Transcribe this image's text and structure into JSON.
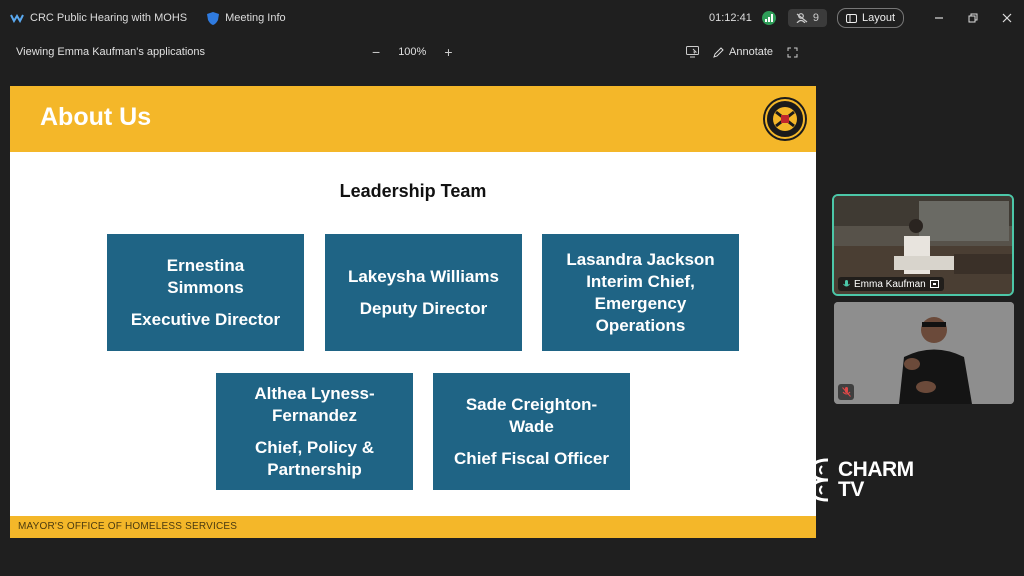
{
  "titlebar": {
    "meeting_title": "CRC Public Hearing with MOHS",
    "meeting_info": "Meeting Info",
    "timer": "01:12:41",
    "participants_count": "9",
    "layout_label": "Layout"
  },
  "sharebar": {
    "viewing_text": "Viewing Emma Kaufman's applications",
    "zoom_level": "100%",
    "annotate_label": "Annotate"
  },
  "slide": {
    "title": "About Us",
    "team_title": "Leadership Team",
    "members": [
      {
        "name": "Ernestina Simmons",
        "role": "Executive Director"
      },
      {
        "name": "Lakeysha Williams",
        "role": "Deputy Director"
      },
      {
        "name": "Lasandra Jackson",
        "role": "Interim Chief, Emergency Operations"
      },
      {
        "name": "Althea Lyness-Fernandez",
        "role": "Chief, Policy & Partnership"
      },
      {
        "name": "Sade Creighton-Wade",
        "role": "Chief Fiscal Officer"
      }
    ],
    "footer": "MAYOR'S OFFICE OF HOMELESS SERVICES"
  },
  "participants": {
    "speaker_name": "Emma Kaufman"
  },
  "watermark": {
    "line1": "CHARM",
    "line2": "TV"
  },
  "colors": {
    "slide_accent": "#f4b729",
    "box_blue": "#1f6485",
    "active_border": "#4cc7a8"
  }
}
